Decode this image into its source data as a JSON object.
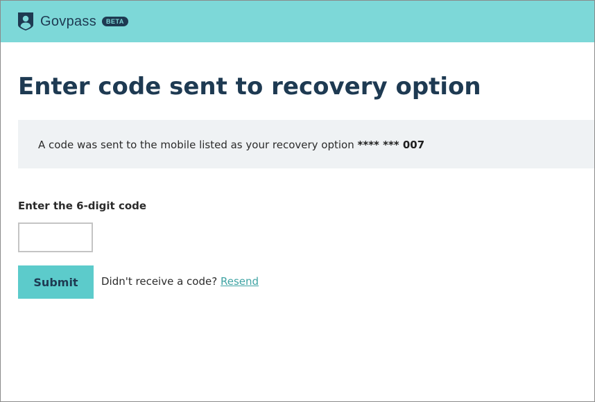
{
  "header": {
    "brand_name": "Govpass",
    "badge": "BETA",
    "logo_icon": "shield-person-icon",
    "background_color": "#7dd8d8",
    "text_color": "#1e3a52"
  },
  "main": {
    "title": "Enter code sent to recovery option",
    "notice": {
      "text": "A code was sent to the mobile listed as your recovery option",
      "masked_number": "**** *** 007"
    },
    "code_field": {
      "label": "Enter the 6-digit code",
      "value": "",
      "placeholder": ""
    },
    "submit_label": "Submit",
    "resend_prompt": "Didn't receive a code?",
    "resend_link": "Resend",
    "accent_color": "#5ccbcb",
    "link_color": "#3fa3a3"
  }
}
